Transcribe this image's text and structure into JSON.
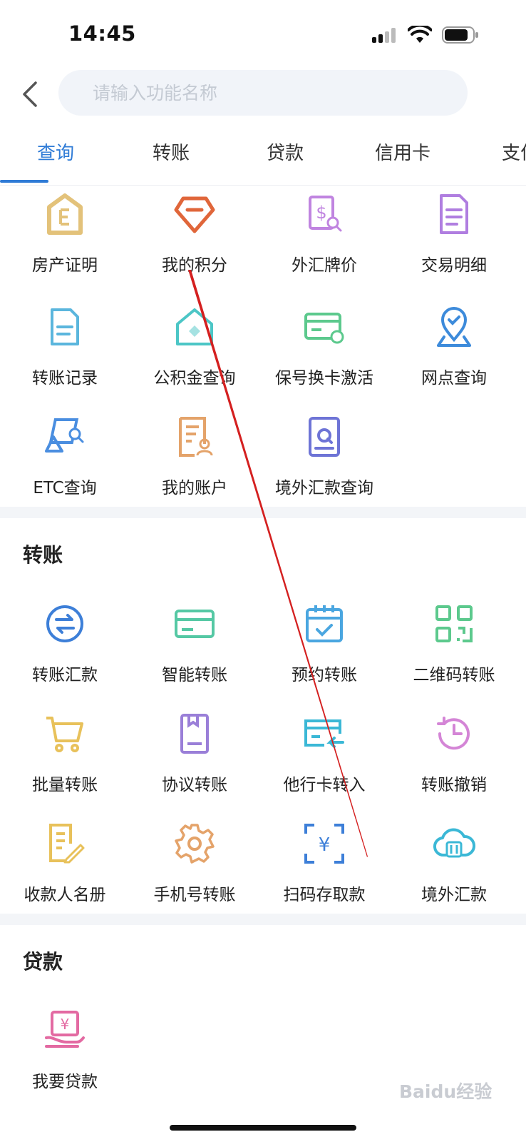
{
  "status_bar": {
    "time": "14:45"
  },
  "search": {
    "placeholder": "请输入功能名称",
    "value": ""
  },
  "tabs": [
    {
      "label": "查询",
      "active": true
    },
    {
      "label": "转账",
      "active": false
    },
    {
      "label": "贷款",
      "active": false
    },
    {
      "label": "信用卡",
      "active": false
    },
    {
      "label": "支付",
      "active": false
    }
  ],
  "query_items": [
    {
      "label": "房产证明",
      "icon": "property-certificate-icon"
    },
    {
      "label": "我的积分",
      "icon": "diamond-icon"
    },
    {
      "label": "外汇牌价",
      "icon": "forex-price-icon"
    },
    {
      "label": "交易明细",
      "icon": "document-icon"
    },
    {
      "label": "转账记录",
      "icon": "record-icon"
    },
    {
      "label": "公积金查询",
      "icon": "house-icon"
    },
    {
      "label": "保号换卡激活",
      "icon": "card-refresh-icon"
    },
    {
      "label": "网点查询",
      "icon": "location-pin-icon"
    },
    {
      "label": "ETC查询",
      "icon": "etc-icon"
    },
    {
      "label": "我的账户",
      "icon": "account-icon"
    },
    {
      "label": "境外汇款查询",
      "icon": "search-doc-icon"
    }
  ],
  "transfer_section": {
    "title": "转账",
    "items": [
      {
        "label": "转账汇款",
        "icon": "transfer-arrows-icon"
      },
      {
        "label": "智能转账",
        "icon": "card-icon"
      },
      {
        "label": "预约转账",
        "icon": "calendar-check-icon"
      },
      {
        "label": "二维码转账",
        "icon": "qr-code-icon"
      },
      {
        "label": "批量转账",
        "icon": "cart-icon"
      },
      {
        "label": "协议转账",
        "icon": "agreement-icon"
      },
      {
        "label": "他行卡转入",
        "icon": "card-transfer-in-icon"
      },
      {
        "label": "转账撤销",
        "icon": "undo-clock-icon"
      },
      {
        "label": "收款人名册",
        "icon": "edit-list-icon"
      },
      {
        "label": "手机号转账",
        "icon": "gear-icon"
      },
      {
        "label": "扫码存取款",
        "icon": "scan-yuan-icon"
      },
      {
        "label": "境外汇款",
        "icon": "cloud-transfer-icon"
      }
    ]
  },
  "loan_section": {
    "title": "贷款",
    "items": [
      {
        "label": "我要贷款",
        "icon": "loan-hand-icon"
      }
    ]
  },
  "watermark": "Baidu经验",
  "colors": {
    "accent": "#2f7bd6",
    "annotation": "#d42020"
  }
}
